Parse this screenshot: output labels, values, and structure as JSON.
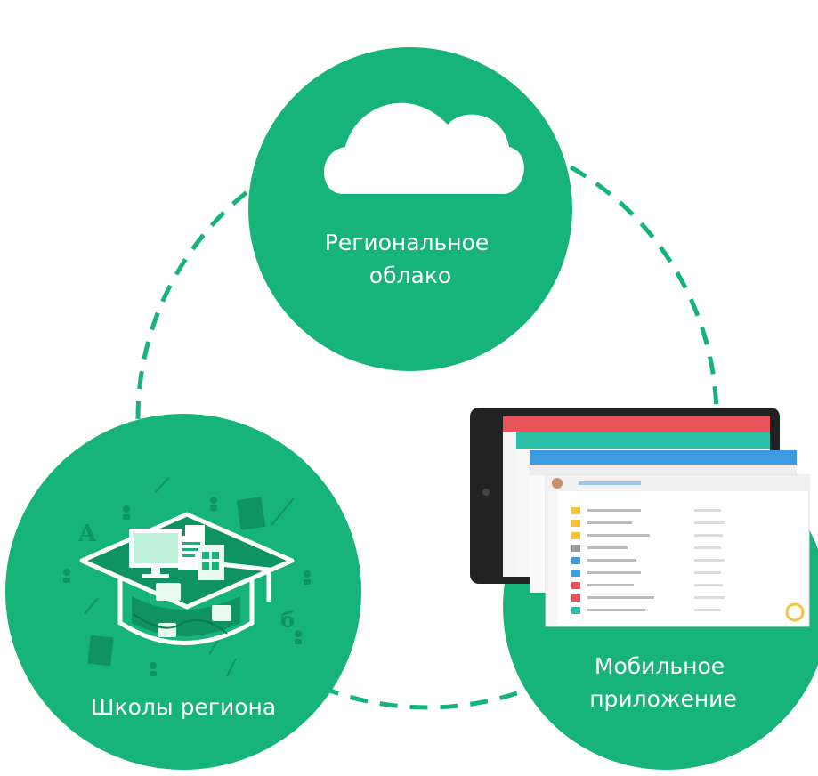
{
  "colors": {
    "primary_green": "#16b47a",
    "dark_green": "#0f9363",
    "dash_green": "#16b47a",
    "white": "#ffffff"
  },
  "nodes": {
    "cloud": {
      "icon": "cloud-icon",
      "label_lines": [
        "Региональное",
        "облако"
      ]
    },
    "schools": {
      "icon": "graduation-cap-icon",
      "label": "Школы региона"
    },
    "mobile": {
      "icon": "tablet-app-icon",
      "label_lines": [
        "Мобильное",
        "приложение"
      ]
    }
  },
  "connections": [
    {
      "from": "cloud",
      "to": "schools",
      "style": "dashed"
    },
    {
      "from": "schools",
      "to": "mobile",
      "style": "dashed"
    },
    {
      "from": "mobile",
      "to": "cloud",
      "style": "dashed"
    }
  ]
}
